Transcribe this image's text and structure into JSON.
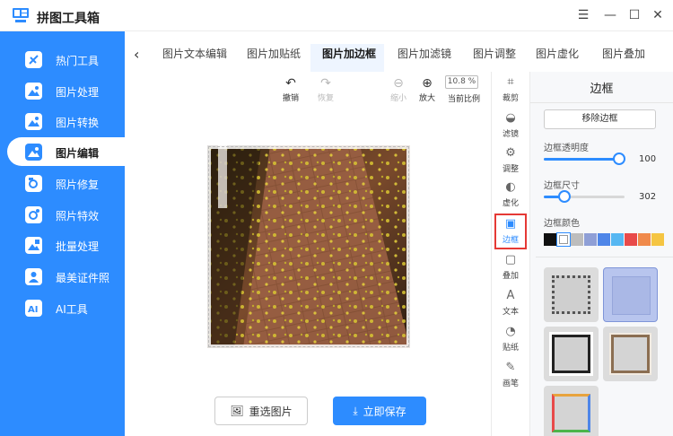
{
  "app": {
    "title": "拼图工具箱",
    "icon": "app-logo-icon"
  },
  "window_controls": {
    "menu": "☰",
    "minimize": "—",
    "maximize": "☐",
    "close": "✕"
  },
  "sidebar": {
    "items": [
      {
        "label": "热门工具",
        "icon": "fire-icon",
        "active": false
      },
      {
        "label": "图片处理",
        "icon": "image-process-icon",
        "active": false
      },
      {
        "label": "图片转换",
        "icon": "image-convert-icon",
        "active": false
      },
      {
        "label": "图片编辑",
        "icon": "image-edit-icon",
        "active": true
      },
      {
        "label": "照片修复",
        "icon": "photo-repair-icon",
        "active": false
      },
      {
        "label": "照片特效",
        "icon": "photo-effect-icon",
        "active": false
      },
      {
        "label": "批量处理",
        "icon": "batch-icon",
        "active": false
      },
      {
        "label": "最美证件照",
        "icon": "id-photo-icon",
        "active": false
      },
      {
        "label": "AI工具",
        "icon": "ai-icon",
        "active": false
      }
    ]
  },
  "tabs": {
    "back": "‹",
    "items": [
      {
        "label": "图片文本编辑",
        "active": false
      },
      {
        "label": "图片加贴纸",
        "active": false
      },
      {
        "label": "图片加边框",
        "active": true
      },
      {
        "label": "图片加滤镜",
        "active": false
      },
      {
        "label": "图片调整",
        "active": false
      },
      {
        "label": "图片虚化",
        "active": false
      },
      {
        "label": "图片叠加",
        "active": false
      }
    ]
  },
  "toolbar": {
    "undo": "撤销",
    "redo": "恢复",
    "zoom_out": "缩小",
    "zoom_in": "放大",
    "zoom_value": "10.8 %",
    "zoom_label": "当前比例"
  },
  "actions": {
    "reselect": "重选图片",
    "save": "立即保存"
  },
  "vtools": {
    "items": [
      {
        "label": "裁剪",
        "icon": "crop-icon",
        "glyph": "⌗",
        "active": false
      },
      {
        "label": "滤镜",
        "icon": "filter-icon",
        "glyph": "◒",
        "active": false
      },
      {
        "label": "调整",
        "icon": "adjust-icon",
        "glyph": "⚙",
        "active": false
      },
      {
        "label": "虚化",
        "icon": "blur-icon",
        "glyph": "◐",
        "active": false
      },
      {
        "label": "边框",
        "icon": "border-icon",
        "glyph": "▣",
        "active": true
      },
      {
        "label": "叠加",
        "icon": "overlay-icon",
        "glyph": "▢",
        "active": false
      },
      {
        "label": "文本",
        "icon": "text-icon",
        "glyph": "A",
        "active": false
      },
      {
        "label": "贴纸",
        "icon": "sticker-icon",
        "glyph": "◔",
        "active": false
      },
      {
        "label": "画笔",
        "icon": "brush-icon",
        "glyph": "✎",
        "active": false
      }
    ]
  },
  "panel": {
    "title": "边框",
    "remove_label": "移除边框",
    "opacity": {
      "label": "边框透明度",
      "value": "100",
      "fraction": 1.0
    },
    "size": {
      "label": "边框尺寸",
      "value": "302",
      "fraction": 0.25
    },
    "color": {
      "label": "边框颜色",
      "swatches": [
        "#111111",
        "#ffffff",
        "#bdbdbd",
        "#8f9fd6",
        "#4f86e8",
        "#56b7f2",
        "#e84a4a",
        "#f08a4b",
        "#f5c542"
      ],
      "selected": 1
    }
  }
}
